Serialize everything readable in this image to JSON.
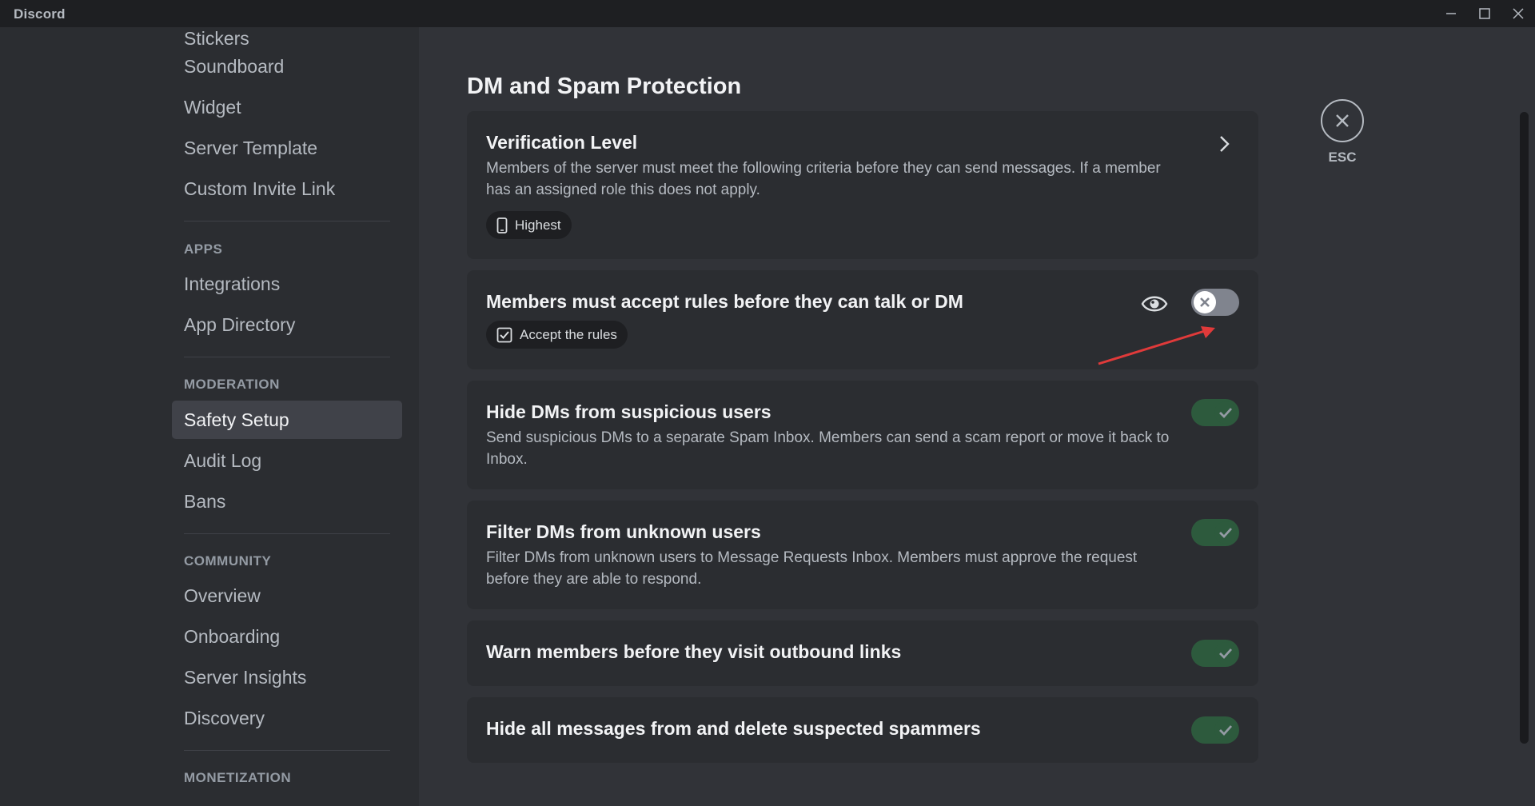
{
  "window": {
    "title": "Discord"
  },
  "sidebar": {
    "items_top": [
      {
        "label": "Stickers"
      },
      {
        "label": "Soundboard"
      },
      {
        "label": "Widget"
      },
      {
        "label": "Server Template"
      },
      {
        "label": "Custom Invite Link"
      }
    ],
    "apps_header": "APPS",
    "apps_items": [
      {
        "label": "Integrations"
      },
      {
        "label": "App Directory"
      }
    ],
    "moderation_header": "MODERATION",
    "moderation_items": [
      {
        "label": "Safety Setup"
      },
      {
        "label": "Audit Log"
      },
      {
        "label": "Bans"
      }
    ],
    "community_header": "COMMUNITY",
    "community_items": [
      {
        "label": "Overview"
      },
      {
        "label": "Onboarding"
      },
      {
        "label": "Server Insights"
      },
      {
        "label": "Discovery"
      }
    ],
    "monetization_header": "MONETIZATION"
  },
  "main": {
    "section_title": "DM and Spam Protection",
    "verification": {
      "title": "Verification Level",
      "description": "Members of the server must meet the following criteria before they can send messages. If a member has an assigned role this does not apply.",
      "pill": "Highest"
    },
    "accept_rules": {
      "title": "Members must accept rules before they can talk or DM",
      "pill": "Accept the rules",
      "enabled": false
    },
    "hide_dms": {
      "title": "Hide DMs from suspicious users",
      "description": "Send suspicious DMs to a separate Spam Inbox. Members can send a scam report or move it back to Inbox.",
      "enabled": true
    },
    "filter_dms": {
      "title": "Filter DMs from unknown users",
      "description": "Filter DMs from unknown users to Message Requests Inbox. Members must approve the request before they are able to respond.",
      "enabled": true
    },
    "warn_links": {
      "title": "Warn members before they visit outbound links",
      "enabled": true
    },
    "hide_spammers": {
      "title": "Hide all messages from and delete suspected spammers",
      "enabled": true
    },
    "esc_label": "ESC"
  },
  "colors": {
    "accent_on": "#2d5a3d",
    "toggle_off": "#80848e",
    "annotation_arrow": "#e03a3a"
  },
  "icons": {
    "phone": "phone-icon",
    "rules": "checkbox-icon",
    "eye": "eye-icon",
    "chevron": "chevron-right-icon",
    "close": "close-icon",
    "check": "check-icon",
    "x": "x-icon"
  }
}
